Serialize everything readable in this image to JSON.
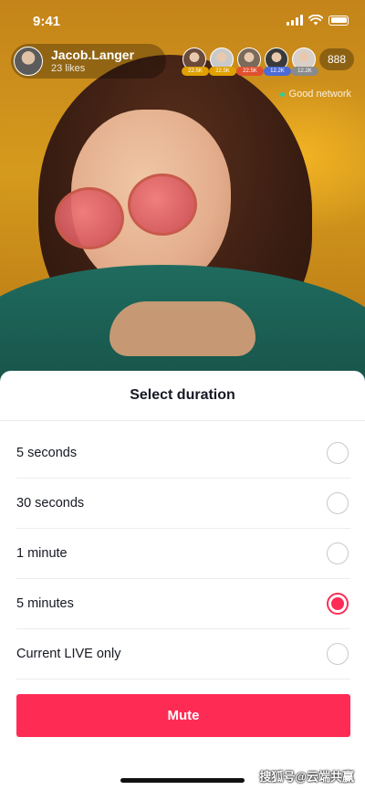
{
  "status_bar": {
    "time": "9:41"
  },
  "host": {
    "name": "Jacob.Langer",
    "likes": "23 likes"
  },
  "viewers": {
    "items": [
      {
        "badge": "22.5K",
        "badge_color": "#e0a000",
        "avatar_color": "#6b4a3a"
      },
      {
        "badge": "22.5K",
        "badge_color": "#e0a000",
        "avatar_color": "#c9c9c9"
      },
      {
        "badge": "22.5K",
        "badge_color": "#e05030",
        "avatar_color": "#7a6a5a"
      },
      {
        "badge": "12.2K",
        "badge_color": "#4b6bd6",
        "avatar_color": "#3a3a3a"
      },
      {
        "badge": "12.2K",
        "badge_color": "#8a8a8a",
        "avatar_color": "#d8d0c8"
      }
    ],
    "count": "888"
  },
  "network_status": "Good network",
  "sheet": {
    "title": "Select duration",
    "options": [
      {
        "label": "5 seconds",
        "selected": false
      },
      {
        "label": "30 seconds",
        "selected": false
      },
      {
        "label": "1 minute",
        "selected": false
      },
      {
        "label": "5 minutes",
        "selected": true
      },
      {
        "label": "Current LIVE only",
        "selected": false
      }
    ],
    "mute_label": "Mute"
  },
  "watermark": "搜狐号@云端共赢",
  "colors": {
    "accent": "#fe2c55"
  }
}
